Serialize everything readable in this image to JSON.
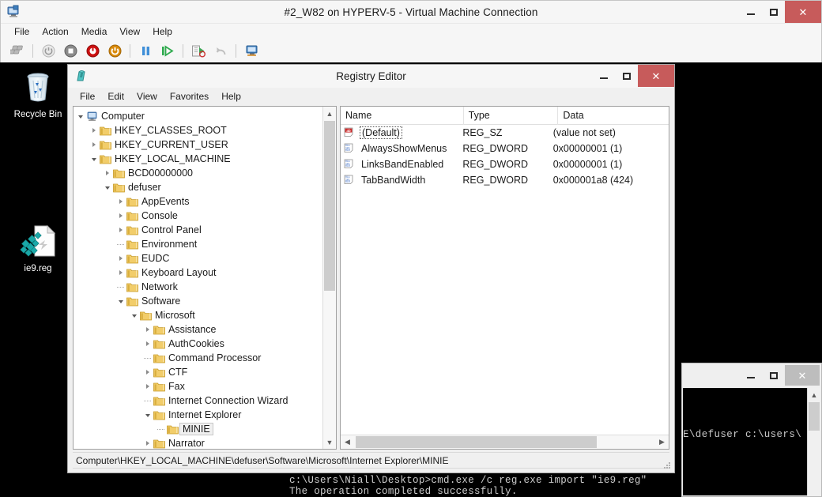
{
  "vm_connection": {
    "title": "#2_W82 on HYPERV-5 - Virtual Machine Connection",
    "icon": "virtual-machine-icon",
    "menus": [
      "File",
      "Action",
      "Media",
      "View",
      "Help"
    ],
    "toolbar_buttons": [
      {
        "name": "ctrl-alt-del-icon",
        "label": "Ctrl+Alt+Delete"
      },
      {
        "name": "start-icon",
        "label": "Start"
      },
      {
        "name": "turn-off-icon",
        "label": "Turn Off"
      },
      {
        "name": "shut-down-icon",
        "label": "Shut Down"
      },
      {
        "name": "save-icon",
        "label": "Save"
      },
      {
        "name": "pause-icon",
        "label": "Pause"
      },
      {
        "name": "reset-icon",
        "label": "Reset"
      },
      {
        "name": "checkpoint-icon",
        "label": "Checkpoint"
      },
      {
        "name": "revert-icon",
        "label": "Revert"
      },
      {
        "name": "enhanced-session-icon",
        "label": "Enhanced Session"
      }
    ],
    "window_controls": {
      "minimize": "Minimize",
      "maximize": "Maximize",
      "close": "Close",
      "close_color": "#c75b5b"
    }
  },
  "desktop": {
    "icons": [
      {
        "name": "recycle-bin-icon",
        "label": "Recycle Bin"
      },
      {
        "name": "reg-file-icon",
        "label": "ie9.reg"
      }
    ],
    "background_color": "#000000"
  },
  "registry_editor": {
    "title": "Registry Editor",
    "icon": "registry-editor-icon",
    "menus": [
      "File",
      "Edit",
      "View",
      "Favorites",
      "Help"
    ],
    "window_controls": {
      "minimize": "Minimize",
      "maximize": "Maximize",
      "close": "Close",
      "close_color": "#c75b5b"
    },
    "tree": [
      {
        "label": "Computer",
        "depth": 0,
        "state": "expanded",
        "icon": "computer-icon"
      },
      {
        "label": "HKEY_CLASSES_ROOT",
        "depth": 1,
        "state": "collapsed",
        "icon": "folder-icon"
      },
      {
        "label": "HKEY_CURRENT_USER",
        "depth": 1,
        "state": "collapsed",
        "icon": "folder-icon"
      },
      {
        "label": "HKEY_LOCAL_MACHINE",
        "depth": 1,
        "state": "expanded",
        "icon": "folder-icon"
      },
      {
        "label": "BCD00000000",
        "depth": 2,
        "state": "collapsed",
        "icon": "folder-icon"
      },
      {
        "label": "defuser",
        "depth": 2,
        "state": "expanded",
        "icon": "folder-icon"
      },
      {
        "label": "AppEvents",
        "depth": 3,
        "state": "collapsed",
        "icon": "folder-icon"
      },
      {
        "label": "Console",
        "depth": 3,
        "state": "collapsed",
        "icon": "folder-icon"
      },
      {
        "label": "Control Panel",
        "depth": 3,
        "state": "collapsed",
        "icon": "folder-icon"
      },
      {
        "label": "Environment",
        "depth": 3,
        "state": "leaf",
        "icon": "folder-icon"
      },
      {
        "label": "EUDC",
        "depth": 3,
        "state": "collapsed",
        "icon": "folder-icon"
      },
      {
        "label": "Keyboard Layout",
        "depth": 3,
        "state": "collapsed",
        "icon": "folder-icon"
      },
      {
        "label": "Network",
        "depth": 3,
        "state": "leaf",
        "icon": "folder-icon"
      },
      {
        "label": "Software",
        "depth": 3,
        "state": "expanded",
        "icon": "folder-icon"
      },
      {
        "label": "Microsoft",
        "depth": 4,
        "state": "expanded",
        "icon": "folder-icon"
      },
      {
        "label": "Assistance",
        "depth": 5,
        "state": "collapsed",
        "icon": "folder-icon"
      },
      {
        "label": "AuthCookies",
        "depth": 5,
        "state": "collapsed",
        "icon": "folder-icon"
      },
      {
        "label": "Command Processor",
        "depth": 5,
        "state": "leaf",
        "icon": "folder-icon"
      },
      {
        "label": "CTF",
        "depth": 5,
        "state": "collapsed",
        "icon": "folder-icon"
      },
      {
        "label": "Fax",
        "depth": 5,
        "state": "collapsed",
        "icon": "folder-icon"
      },
      {
        "label": "Internet Connection Wizard",
        "depth": 5,
        "state": "leaf",
        "icon": "folder-icon"
      },
      {
        "label": "Internet Explorer",
        "depth": 5,
        "state": "expanded",
        "icon": "folder-icon"
      },
      {
        "label": "MINIE",
        "depth": 6,
        "state": "leaf",
        "icon": "folder-icon",
        "selected": true
      },
      {
        "label": "Narrator",
        "depth": 5,
        "state": "collapsed",
        "icon": "folder-icon"
      }
    ],
    "list": {
      "columns": [
        "Name",
        "Type",
        "Data"
      ],
      "rows": [
        {
          "name": "(Default)",
          "type": "REG_SZ",
          "data": "(value not set)",
          "icon": "string-value-icon",
          "focused": true
        },
        {
          "name": "AlwaysShowMenus",
          "type": "REG_DWORD",
          "data": "0x00000001 (1)",
          "icon": "dword-value-icon",
          "focused": false
        },
        {
          "name": "LinksBandEnabled",
          "type": "REG_DWORD",
          "data": "0x00000001 (1)",
          "icon": "dword-value-icon",
          "focused": false
        },
        {
          "name": "TabBandWidth",
          "type": "REG_DWORD",
          "data": "0x000001a8 (424)",
          "icon": "dword-value-icon",
          "focused": false
        }
      ]
    },
    "status_bar": "Computer\\HKEY_LOCAL_MACHINE\\defuser\\Software\\Microsoft\\Internet Explorer\\MINIE"
  },
  "command_prompt": {
    "visible_text": "E\\defuser c:\\users\\",
    "window_controls": {
      "minimize": "Minimize",
      "maximize": "Maximize",
      "close": "Close",
      "close_color": "#bdbdbd"
    }
  },
  "console_output": {
    "line1": "c:\\Users\\Niall\\Desktop>cmd.exe /c reg.exe import \"ie9.reg\"",
    "line2": "The operation completed successfully."
  }
}
